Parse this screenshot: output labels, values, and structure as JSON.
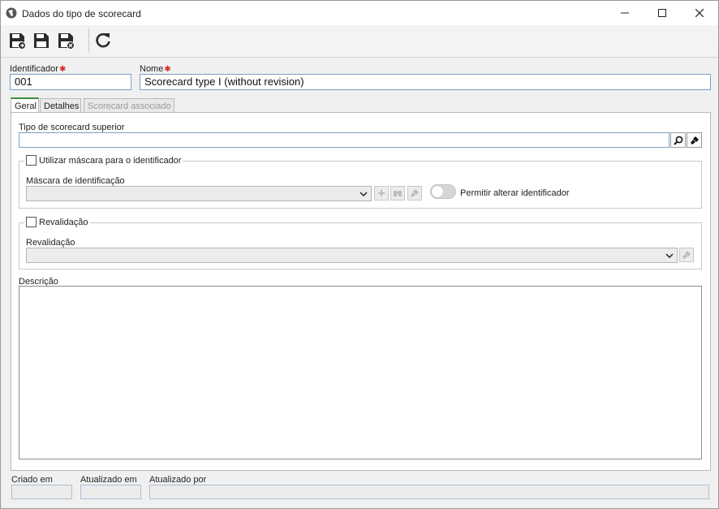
{
  "window": {
    "title": "Dados do tipo de scorecard"
  },
  "form": {
    "identifier_label": "Identificador",
    "identifier_value": "001",
    "name_label": "Nome",
    "name_value": "Scorecard type I (without revision)",
    "required_mark": "✱"
  },
  "tabs": [
    {
      "label": "Geral",
      "state": "active"
    },
    {
      "label": "Detalhes",
      "state": "normal"
    },
    {
      "label": "Scorecard associado",
      "state": "disabled"
    }
  ],
  "general": {
    "parent_type_label": "Tipo de scorecard superior",
    "parent_type_value": "",
    "use_mask_label": "Utilizar máscara para o identificador",
    "use_mask_checked": false,
    "mask_label": "Máscara de identificação",
    "mask_value": "",
    "allow_change_label": "Permitir alterar identificador",
    "revalidation_check_label": "Revalidação",
    "revalidation_checked": false,
    "revalidation_label": "Revalidação",
    "revalidation_value": "",
    "description_label": "Descrição",
    "description_value": ""
  },
  "footer": {
    "created_label": "Criado em",
    "updated_label": "Atualizado em",
    "updated_by_label": "Atualizado por"
  },
  "colors": {
    "accent_tab": "#3c8c3c",
    "required": "#d9261c",
    "input_border": "#7aa0c8"
  }
}
